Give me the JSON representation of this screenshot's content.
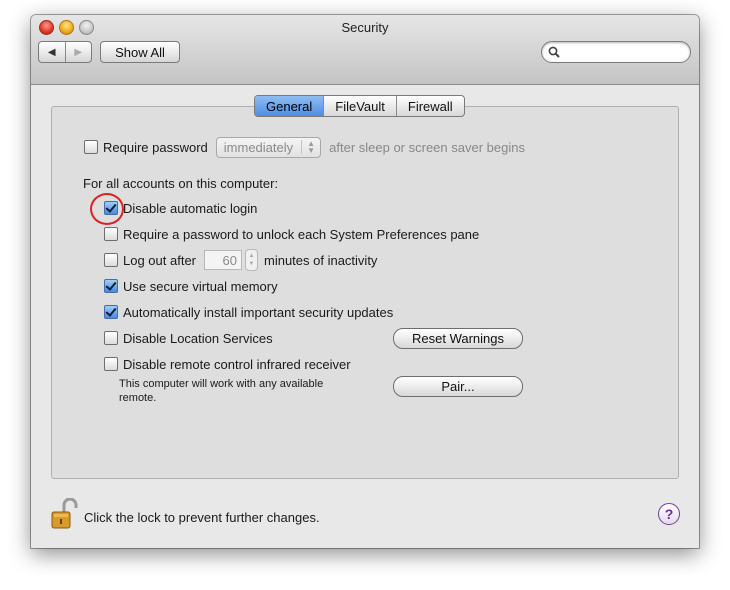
{
  "window": {
    "title": "Security"
  },
  "toolbar": {
    "back_glyph": "◀",
    "forward_glyph": "▶",
    "show_all_label": "Show All",
    "search_placeholder": ""
  },
  "tabs": [
    {
      "label": "General",
      "active": true
    },
    {
      "label": "FileVault",
      "active": false
    },
    {
      "label": "Firewall",
      "active": false
    }
  ],
  "general": {
    "require_password": {
      "label": "Require password",
      "checked": false,
      "selected_option": "immediately",
      "suffix": "after sleep or screen saver begins"
    },
    "section_label": "For all accounts on this computer:",
    "options": {
      "disable_auto_login": {
        "label": "Disable automatic login",
        "checked": true
      },
      "require_pw_prefs": {
        "label": "Require a password to unlock each System Preferences pane",
        "checked": false
      },
      "logout_prefix": "Log out after",
      "logout_minutes": "60",
      "logout_suffix": "minutes of inactivity",
      "secure_vm": {
        "label": "Use secure virtual memory",
        "checked": true
      },
      "auto_updates": {
        "label": "Automatically install important security updates",
        "checked": true
      },
      "disable_location": {
        "label": "Disable Location Services",
        "checked": false
      },
      "disable_ir": {
        "label": "Disable remote control infrared receiver",
        "checked": false
      }
    },
    "ir_note_line1": "This computer will work with any available",
    "ir_note_line2": "remote.",
    "reset_warnings_label": "Reset Warnings",
    "pair_label": "Pair..."
  },
  "footer": {
    "lock_text": "Click the lock to prevent further changes.",
    "help_glyph": "?"
  },
  "colors": {
    "highlight_circle": "#e02020",
    "accent_blue": "#4d8ee0"
  }
}
